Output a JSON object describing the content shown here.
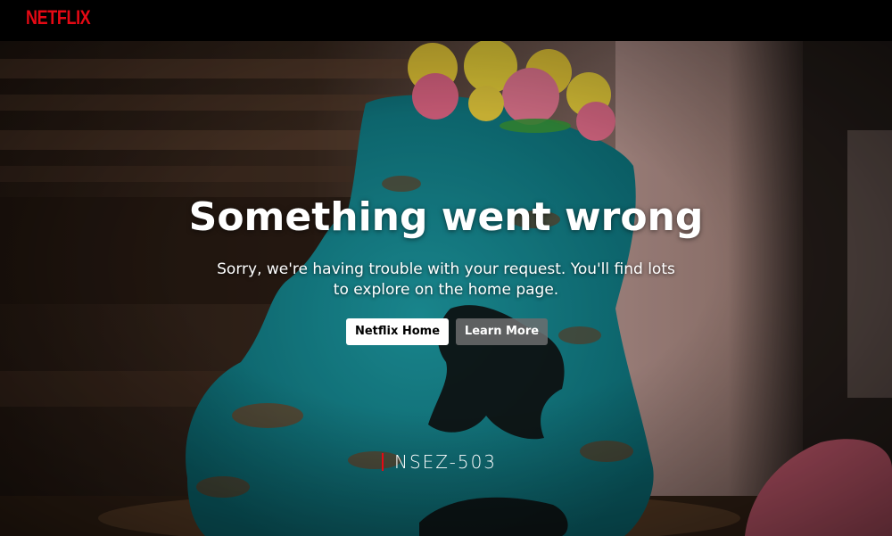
{
  "header": {
    "logo_text": "NETFLIX",
    "brand_color": "#e50914"
  },
  "error": {
    "title": "Something went wrong",
    "message": "Sorry, we're having trouble with your request. You'll find lots to explore on the home page.",
    "code": "NSEZ-503"
  },
  "buttons": {
    "home_label": "Netflix Home",
    "learn_more_label": "Learn More"
  },
  "colors": {
    "background": "#000000",
    "primary_button_bg": "#ffffff",
    "secondary_button_bg": "#6d6d6e",
    "text": "#ffffff"
  }
}
